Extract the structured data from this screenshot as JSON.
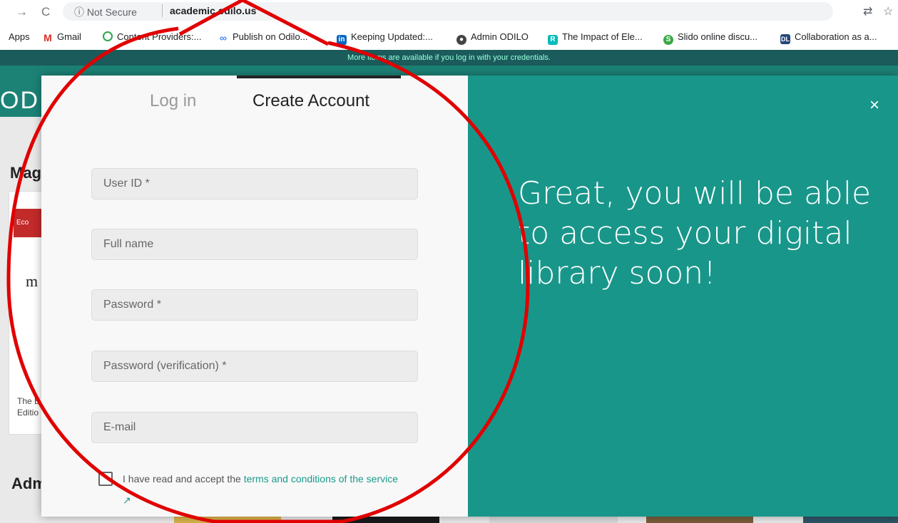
{
  "browser": {
    "security_label": "ⓘ Not Secure",
    "url": "academic.odilo.us"
  },
  "bookmarks": [
    {
      "label": "Apps"
    },
    {
      "label": "Gmail"
    },
    {
      "label": "Content Providers:..."
    },
    {
      "label": "Publish on Odilo..."
    },
    {
      "label": "Keeping Updated:..."
    },
    {
      "label": "Admin ODILO"
    },
    {
      "label": "The Impact of Ele..."
    },
    {
      "label": "Slido online discu..."
    },
    {
      "label": "Collaboration as a..."
    }
  ],
  "background_page": {
    "banner": "More items are available if you log in with your credentials.",
    "logo_fragment": "ODI",
    "section1_fragment": "Mag",
    "section2_fragment": "Adm",
    "card_thumb_text": "Eco",
    "card_letter": "m",
    "card_caption_line1": "The E",
    "card_caption_line2": "Editio"
  },
  "modal": {
    "tabs": [
      {
        "label": "Log in",
        "active": false
      },
      {
        "label": "Create Account",
        "active": true
      }
    ],
    "fields": {
      "user_id": {
        "placeholder": "User ID *",
        "value": ""
      },
      "full_name": {
        "placeholder": "Full name",
        "value": ""
      },
      "password": {
        "placeholder": "Password *",
        "value": ""
      },
      "password_verify": {
        "placeholder": "Password (verification) *",
        "value": ""
      },
      "email": {
        "placeholder": "E-mail",
        "value": ""
      }
    },
    "terms_prefix": "I have read and accept the ",
    "terms_link": "terms and conditions of the service",
    "close_label": "×",
    "hero_text": "Great, you will be able to access your digital library soon!"
  },
  "colors": {
    "accent": "#19968a",
    "annotation": "#e00000"
  }
}
